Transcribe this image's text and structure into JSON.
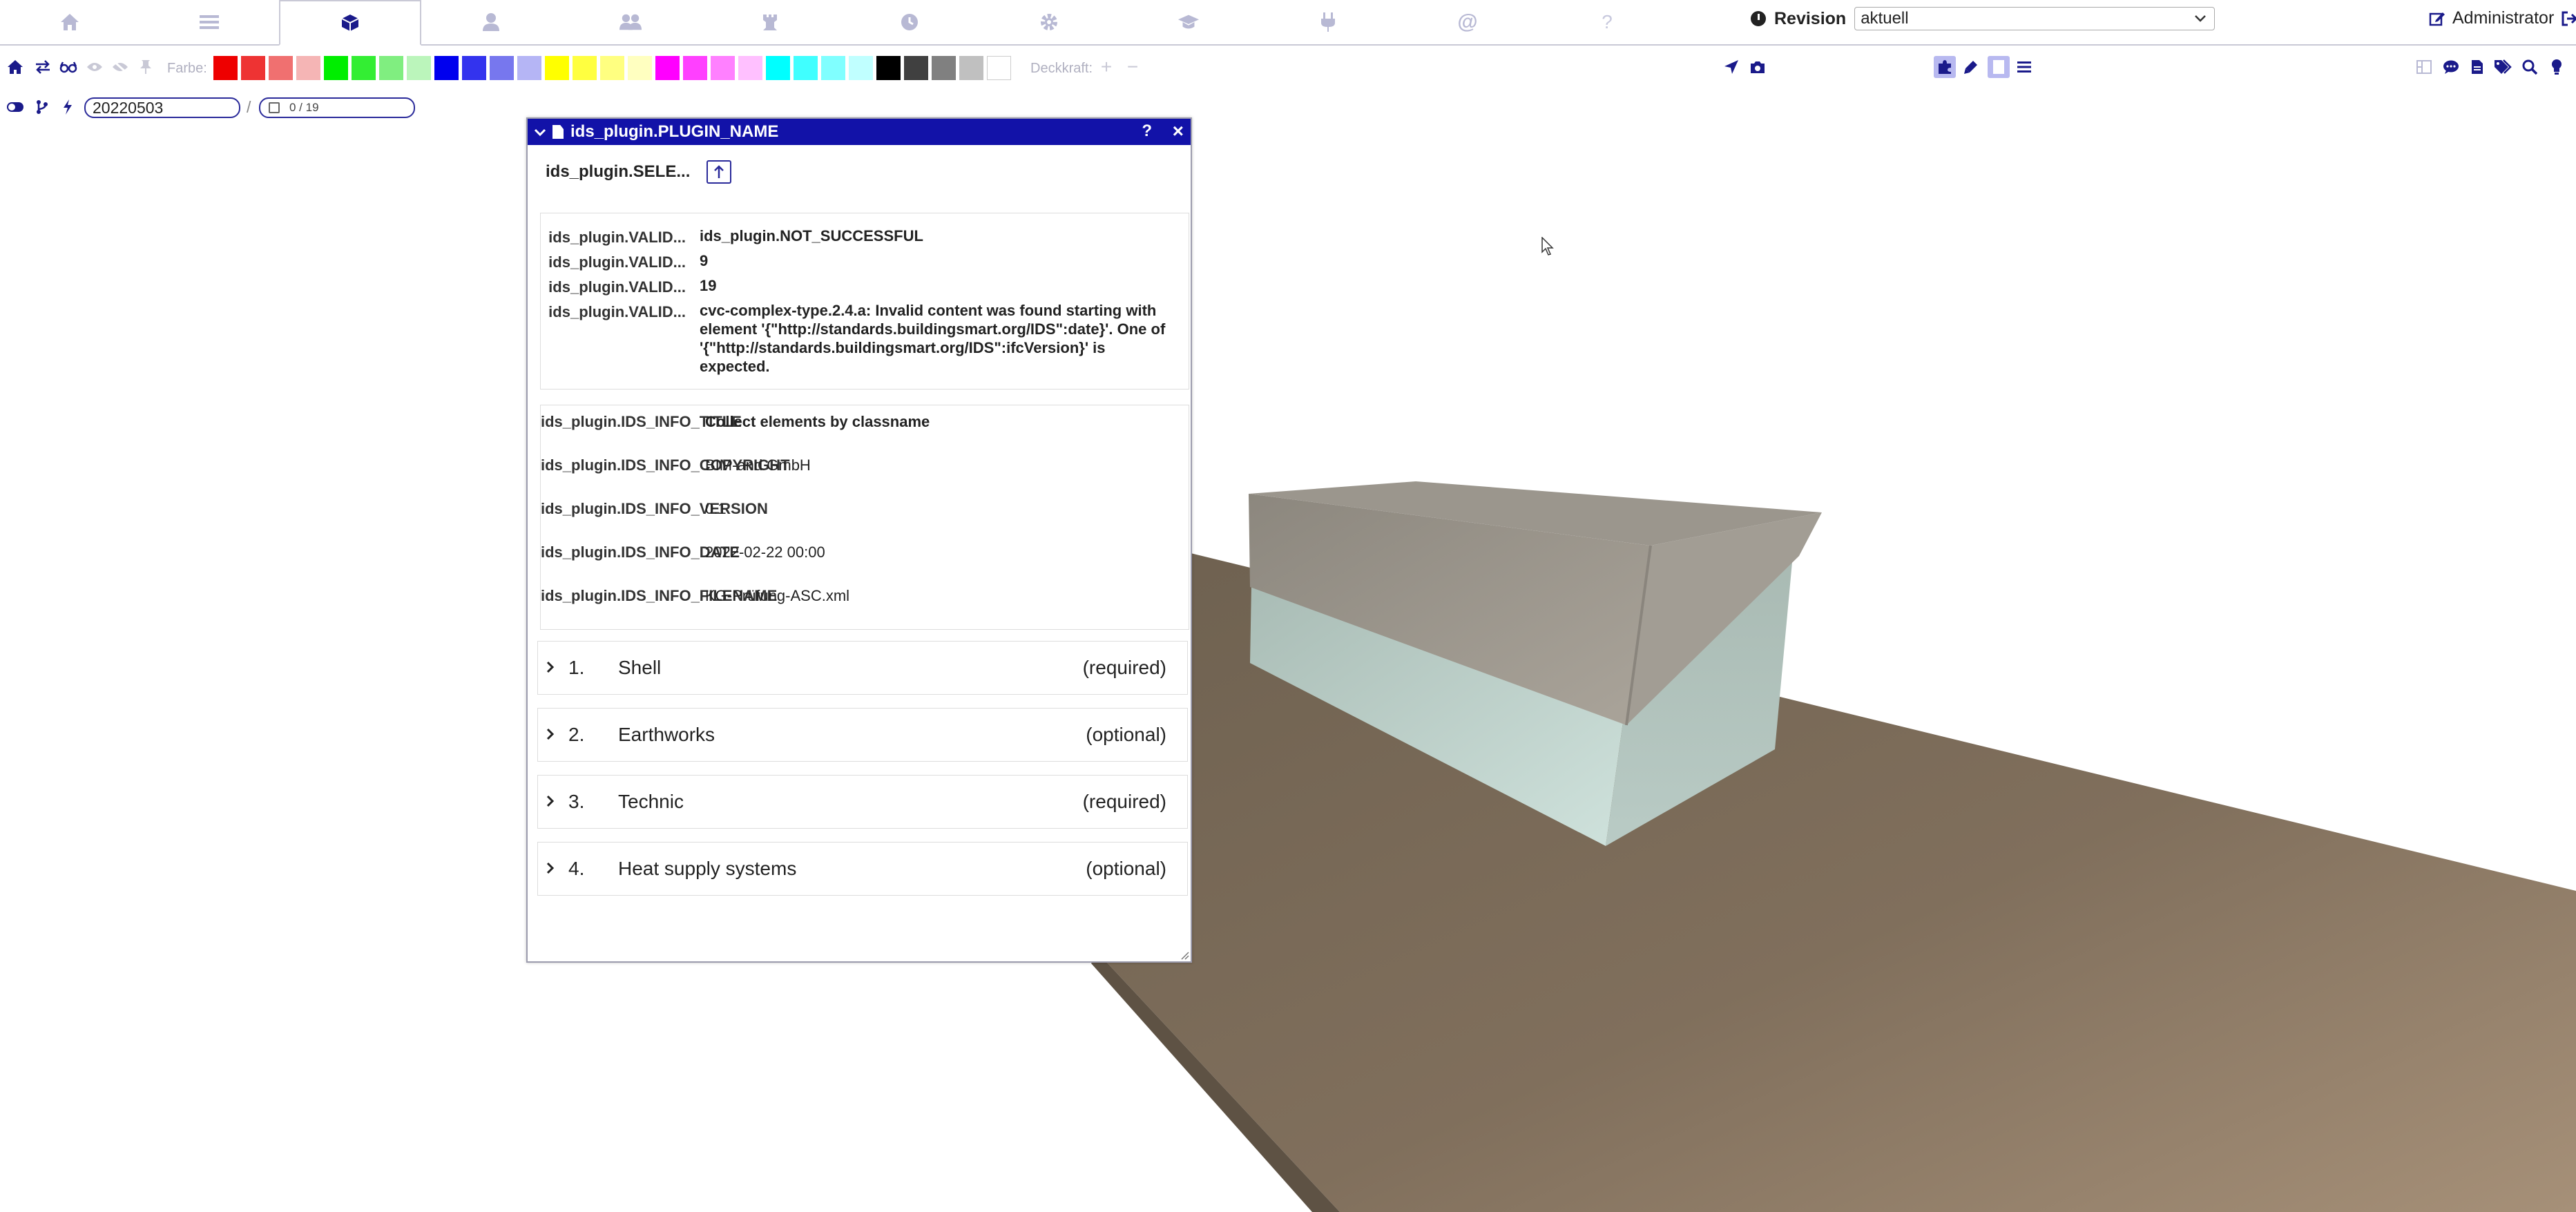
{
  "nav": {
    "tabs": [
      {
        "icon": "home-icon"
      },
      {
        "icon": "list-icon"
      },
      {
        "icon": "cube-icon",
        "active": true
      },
      {
        "icon": "user-icon"
      },
      {
        "icon": "users-icon"
      },
      {
        "icon": "chess-rook-icon"
      },
      {
        "icon": "clock-icon"
      },
      {
        "icon": "gear-icon"
      },
      {
        "icon": "graduation-cap-icon"
      },
      {
        "icon": "plug-icon"
      },
      {
        "icon": "at-icon"
      },
      {
        "icon": "help-icon",
        "glyph": "?"
      }
    ],
    "revision_label": "Revision",
    "revision_value": "aktuell",
    "user": "Administrator"
  },
  "toolbar": {
    "farbe_label": "Farbe:",
    "deckkraft_label": "Deckkraft:",
    "swatches": [
      "#ee0000",
      "#ee3333",
      "#f07070",
      "#f5b5b5",
      "#00ee00",
      "#33ee33",
      "#80ee80",
      "#bbf5bb",
      "#0000ee",
      "#3333ee",
      "#7777ee",
      "#b5b5f5",
      "#ffff00",
      "#ffff40",
      "#ffff80",
      "#ffffc0",
      "#ff00ff",
      "#ff40ff",
      "#ff80ff",
      "#ffc0ff",
      "#00ffff",
      "#40ffff",
      "#80ffff",
      "#c0ffff",
      "#000000",
      "#404040",
      "#808080",
      "#c0c0c0",
      "#ffffff"
    ]
  },
  "row2": {
    "date_value": "20220503",
    "counter": "0 / 19"
  },
  "dialog": {
    "title": "ids_plugin.PLUGIN_NAME",
    "help": "?",
    "close": "×",
    "select_label": "ids_plugin.SELE...",
    "validation": [
      {
        "key": "ids_plugin.VALID...",
        "value": "ids_plugin.NOT_SUCCESSFUL"
      },
      {
        "key": "ids_plugin.VALID...",
        "value": "9"
      },
      {
        "key": "ids_plugin.VALID...",
        "value": "19"
      },
      {
        "key": "ids_plugin.VALID...",
        "value": "cvc-complex-type.2.4.a: Invalid content was found starting with element '{\"http://standards.buildingsmart.org/IDS\":date}'. One of '{\"http://standards.buildingsmart.org/IDS\":ifcVersion}' is expected."
      }
    ],
    "info": [
      {
        "key": "ids_plugin.IDS_INFO_TITLE",
        "value": "Collect elements by classname"
      },
      {
        "key": "ids_plugin.IDS_INFO_COPYRIGHT",
        "value": "BIM-and GmbH"
      },
      {
        "key": "ids_plugin.IDS_INFO_VERSION",
        "value": "0.1"
      },
      {
        "key": "ids_plugin.IDS_INFO_DATE",
        "value": "2022-02-22 00:00"
      },
      {
        "key": "ids_plugin.IDS_INFO_FILENAME",
        "value": "KG-Prüfung-ASC.xml"
      }
    ],
    "sections": [
      {
        "num": "1.",
        "name": "Shell",
        "req": "(required)"
      },
      {
        "num": "2.",
        "name": "Earthworks",
        "req": "(optional)"
      },
      {
        "num": "3.",
        "name": "Technic",
        "req": "(required)"
      },
      {
        "num": "4.",
        "name": "Heat supply systems",
        "req": "(optional)"
      }
    ]
  }
}
